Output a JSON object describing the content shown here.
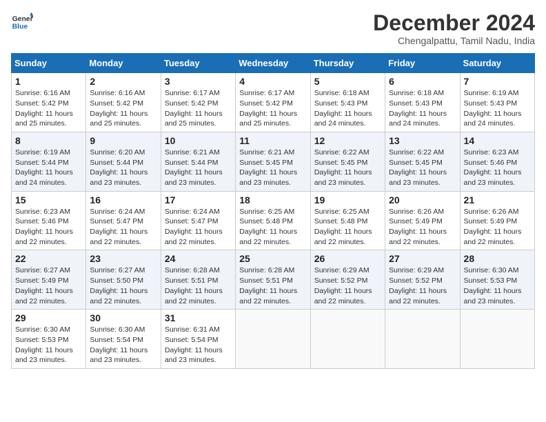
{
  "header": {
    "logo_line1": "General",
    "logo_line2": "Blue",
    "main_title": "December 2024",
    "subtitle": "Chengalpattu, Tamil Nadu, India"
  },
  "days_of_week": [
    "Sunday",
    "Monday",
    "Tuesday",
    "Wednesday",
    "Thursday",
    "Friday",
    "Saturday"
  ],
  "weeks": [
    [
      {
        "day": "1",
        "info": "Sunrise: 6:16 AM\nSunset: 5:42 PM\nDaylight: 11 hours\nand 25 minutes."
      },
      {
        "day": "2",
        "info": "Sunrise: 6:16 AM\nSunset: 5:42 PM\nDaylight: 11 hours\nand 25 minutes."
      },
      {
        "day": "3",
        "info": "Sunrise: 6:17 AM\nSunset: 5:42 PM\nDaylight: 11 hours\nand 25 minutes."
      },
      {
        "day": "4",
        "info": "Sunrise: 6:17 AM\nSunset: 5:42 PM\nDaylight: 11 hours\nand 25 minutes."
      },
      {
        "day": "5",
        "info": "Sunrise: 6:18 AM\nSunset: 5:43 PM\nDaylight: 11 hours\nand 24 minutes."
      },
      {
        "day": "6",
        "info": "Sunrise: 6:18 AM\nSunset: 5:43 PM\nDaylight: 11 hours\nand 24 minutes."
      },
      {
        "day": "7",
        "info": "Sunrise: 6:19 AM\nSunset: 5:43 PM\nDaylight: 11 hours\nand 24 minutes."
      }
    ],
    [
      {
        "day": "8",
        "info": "Sunrise: 6:19 AM\nSunset: 5:44 PM\nDaylight: 11 hours\nand 24 minutes."
      },
      {
        "day": "9",
        "info": "Sunrise: 6:20 AM\nSunset: 5:44 PM\nDaylight: 11 hours\nand 23 minutes."
      },
      {
        "day": "10",
        "info": "Sunrise: 6:21 AM\nSunset: 5:44 PM\nDaylight: 11 hours\nand 23 minutes."
      },
      {
        "day": "11",
        "info": "Sunrise: 6:21 AM\nSunset: 5:45 PM\nDaylight: 11 hours\nand 23 minutes."
      },
      {
        "day": "12",
        "info": "Sunrise: 6:22 AM\nSunset: 5:45 PM\nDaylight: 11 hours\nand 23 minutes."
      },
      {
        "day": "13",
        "info": "Sunrise: 6:22 AM\nSunset: 5:45 PM\nDaylight: 11 hours\nand 23 minutes."
      },
      {
        "day": "14",
        "info": "Sunrise: 6:23 AM\nSunset: 5:46 PM\nDaylight: 11 hours\nand 23 minutes."
      }
    ],
    [
      {
        "day": "15",
        "info": "Sunrise: 6:23 AM\nSunset: 5:46 PM\nDaylight: 11 hours\nand 22 minutes."
      },
      {
        "day": "16",
        "info": "Sunrise: 6:24 AM\nSunset: 5:47 PM\nDaylight: 11 hours\nand 22 minutes."
      },
      {
        "day": "17",
        "info": "Sunrise: 6:24 AM\nSunset: 5:47 PM\nDaylight: 11 hours\nand 22 minutes."
      },
      {
        "day": "18",
        "info": "Sunrise: 6:25 AM\nSunset: 5:48 PM\nDaylight: 11 hours\nand 22 minutes."
      },
      {
        "day": "19",
        "info": "Sunrise: 6:25 AM\nSunset: 5:48 PM\nDaylight: 11 hours\nand 22 minutes."
      },
      {
        "day": "20",
        "info": "Sunrise: 6:26 AM\nSunset: 5:49 PM\nDaylight: 11 hours\nand 22 minutes."
      },
      {
        "day": "21",
        "info": "Sunrise: 6:26 AM\nSunset: 5:49 PM\nDaylight: 11 hours\nand 22 minutes."
      }
    ],
    [
      {
        "day": "22",
        "info": "Sunrise: 6:27 AM\nSunset: 5:49 PM\nDaylight: 11 hours\nand 22 minutes."
      },
      {
        "day": "23",
        "info": "Sunrise: 6:27 AM\nSunset: 5:50 PM\nDaylight: 11 hours\nand 22 minutes."
      },
      {
        "day": "24",
        "info": "Sunrise: 6:28 AM\nSunset: 5:51 PM\nDaylight: 11 hours\nand 22 minutes."
      },
      {
        "day": "25",
        "info": "Sunrise: 6:28 AM\nSunset: 5:51 PM\nDaylight: 11 hours\nand 22 minutes."
      },
      {
        "day": "26",
        "info": "Sunrise: 6:29 AM\nSunset: 5:52 PM\nDaylight: 11 hours\nand 22 minutes."
      },
      {
        "day": "27",
        "info": "Sunrise: 6:29 AM\nSunset: 5:52 PM\nDaylight: 11 hours\nand 22 minutes."
      },
      {
        "day": "28",
        "info": "Sunrise: 6:30 AM\nSunset: 5:53 PM\nDaylight: 11 hours\nand 23 minutes."
      }
    ],
    [
      {
        "day": "29",
        "info": "Sunrise: 6:30 AM\nSunset: 5:53 PM\nDaylight: 11 hours\nand 23 minutes."
      },
      {
        "day": "30",
        "info": "Sunrise: 6:30 AM\nSunset: 5:54 PM\nDaylight: 11 hours\nand 23 minutes."
      },
      {
        "day": "31",
        "info": "Sunrise: 6:31 AM\nSunset: 5:54 PM\nDaylight: 11 hours\nand 23 minutes."
      },
      {
        "day": "",
        "info": ""
      },
      {
        "day": "",
        "info": ""
      },
      {
        "day": "",
        "info": ""
      },
      {
        "day": "",
        "info": ""
      }
    ]
  ]
}
